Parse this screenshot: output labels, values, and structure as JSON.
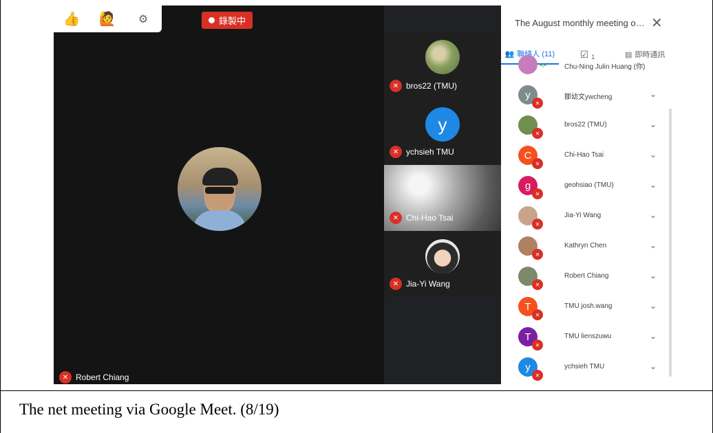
{
  "caption": "The net meeting via Google Meet. (8/19)",
  "toolbar": {
    "thumbs_icon": "thumbs-up-icon",
    "raise_hand_icon": "raise-hand-icon",
    "settings_icon": "gear-icon",
    "thumbs_glyph": "👍",
    "hand_glyph": "🙋",
    "gear_glyph": "⚙"
  },
  "recording": {
    "label": "錄製中"
  },
  "main_video": {
    "name": "Robert Chiang"
  },
  "tiles": [
    {
      "name": "bros22 (TMU)"
    },
    {
      "name": "ychsieh TMU",
      "letter": "y"
    },
    {
      "name": "Chi-Hao Tsai"
    },
    {
      "name": "Jia-Yi Wang"
    }
  ],
  "panel": {
    "title": "The August monthly meeting of...",
    "close_glyph": "✕",
    "tabs": [
      {
        "label": "聯絡人 (11)",
        "glyph": "👥"
      },
      {
        "label": "1",
        "glyph": "☑"
      },
      {
        "label": "即時通訊",
        "glyph": "▤"
      }
    ],
    "people": [
      {
        "name": "Chu-Ning Julin Huang (你)",
        "letter": "",
        "color": "#c77dbb",
        "speaking": true
      },
      {
        "name": "鄒幼文ywcheng",
        "letter": "y",
        "color": "#7f8c8d"
      },
      {
        "name": "bros22 (TMU)",
        "letter": "",
        "color": "#6f8f4e"
      },
      {
        "name": "Chi-Hao Tsai",
        "letter": "C",
        "color": "#f4511e"
      },
      {
        "name": "geohsiao (TMU)",
        "letter": "g",
        "color": "#d81b60"
      },
      {
        "name": "Jia-Yi Wang",
        "letter": "",
        "color": "#c9a48a"
      },
      {
        "name": "Kathryn Chen",
        "letter": "",
        "color": "#b08060"
      },
      {
        "name": "Robert Chiang",
        "letter": "",
        "color": "#7a8a6a"
      },
      {
        "name": "TMU josh.wang",
        "letter": "T",
        "color": "#f4511e"
      },
      {
        "name": "TMU lienszuwu",
        "letter": "T",
        "color": "#7b1fa2"
      },
      {
        "name": "ychsieh TMU",
        "letter": "y",
        "color": "#1e88e5"
      }
    ]
  }
}
